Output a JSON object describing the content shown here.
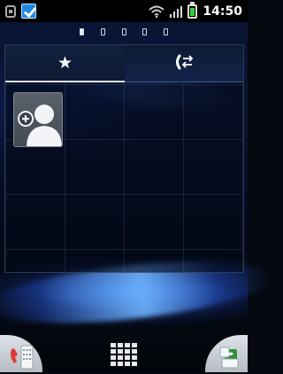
{
  "status_bar": {
    "time": "14:50",
    "icons": [
      "usb-debugging-icon",
      "task-done-icon",
      "wifi-icon",
      "signal-icon",
      "battery-icon"
    ],
    "battery_color": "#34d13a"
  },
  "home": {
    "pages": 5,
    "active_page": 0
  },
  "widget": {
    "tabs": [
      {
        "icon": "star-icon",
        "glyph": "★",
        "selected": true
      },
      {
        "icon": "recent-calls-icon",
        "selected": false
      }
    ],
    "add_contact_icon": "add-contact-icon"
  },
  "dock": {
    "left_icon": "phone-icon",
    "center_icon": "app-drawer-icon",
    "right_icon": "messaging-icon"
  },
  "colors": {
    "accent": "#1e88e5",
    "wallpaper_glow": "#6eb4ff"
  }
}
